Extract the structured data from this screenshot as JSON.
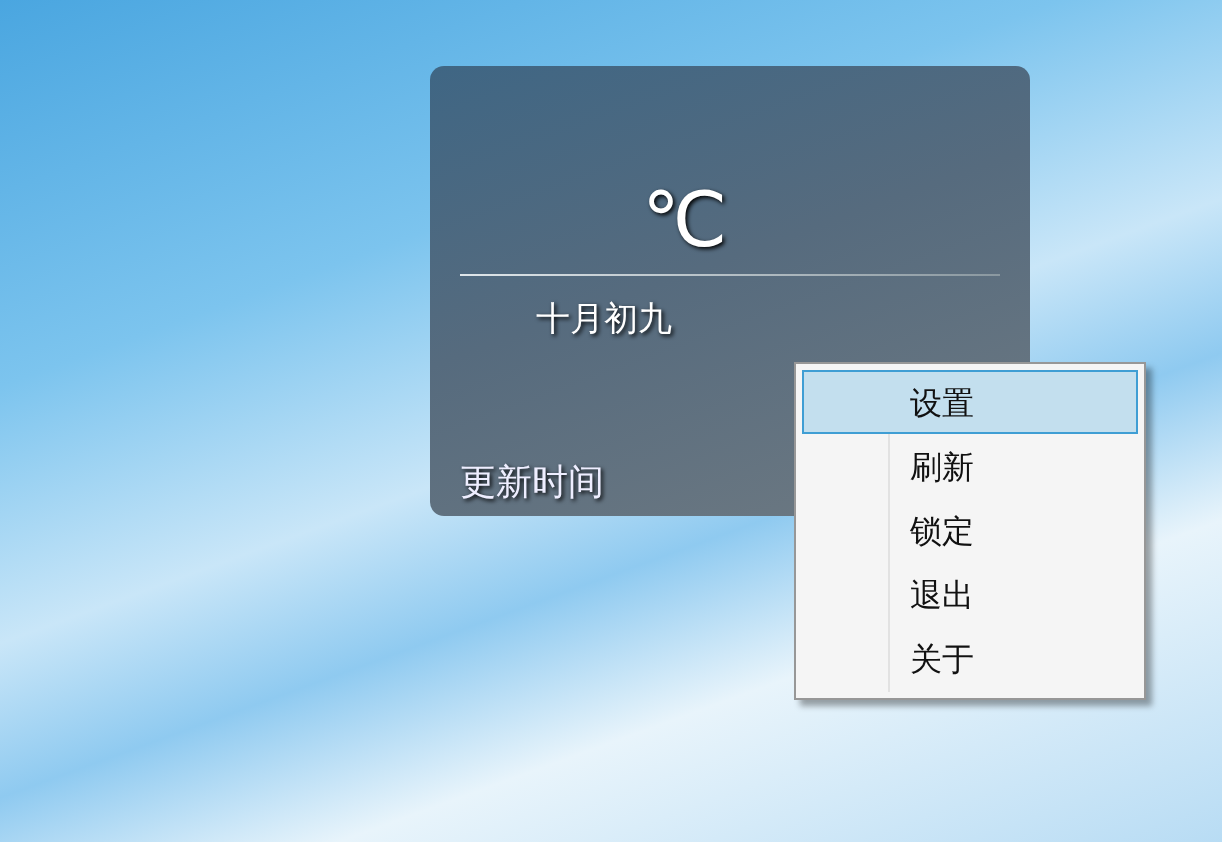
{
  "widget": {
    "temperature": "℃",
    "lunar_date": "十月初九",
    "update_label": "更新时间"
  },
  "context_menu": {
    "items": [
      {
        "label": "设置",
        "selected": true
      },
      {
        "label": "刷新",
        "selected": false
      },
      {
        "label": "锁定",
        "selected": false
      },
      {
        "label": "退出",
        "selected": false
      },
      {
        "label": "关于",
        "selected": false
      }
    ]
  }
}
